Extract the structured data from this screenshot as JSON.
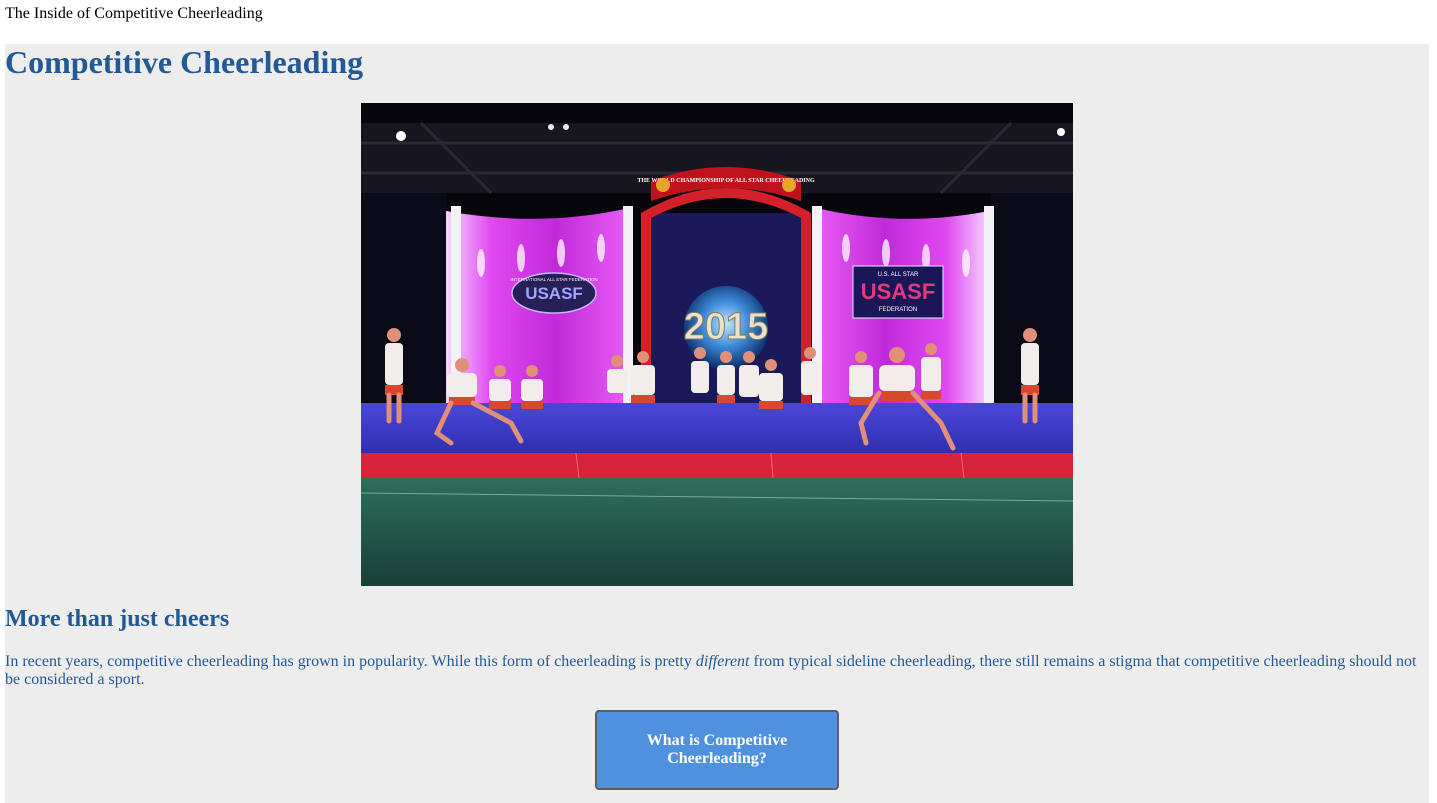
{
  "document": {
    "title": "The Inside of Competitive Cheerleading"
  },
  "main": {
    "heading": "Competitive Cheerleading",
    "image": {
      "alt": "Cheerleading team performing on stage at the 2015 World Championship of All Star Cheerleading",
      "banner_text": "THE WORLD CHAMPIONSHIP OF ALL STAR CHEERLEADING",
      "year": "2015",
      "left_logo": "USASF",
      "left_logo_caption": "INTERNATIONAL ALL STAR FEDERATION",
      "right_logo_top": "U.S. ALL STAR",
      "right_logo": "USASF",
      "right_logo_caption": "FEDERATION"
    },
    "section_heading": "More than just cheers",
    "intro": {
      "before": "In recent years, competitive cheerleading has grown in popularity. While this form of cheerleading is pretty ",
      "emphasis": "different",
      "after": " from typical sideline cheerleading, there still remains a stigma that competitive cheerleading should not be considered a sport."
    },
    "cta_label": "What is Competitive Cheerleading?"
  },
  "colors": {
    "heading": "#235a96",
    "panel_background": "#ededed",
    "button_background": "#4f91de",
    "button_border": "#5a5f66"
  }
}
